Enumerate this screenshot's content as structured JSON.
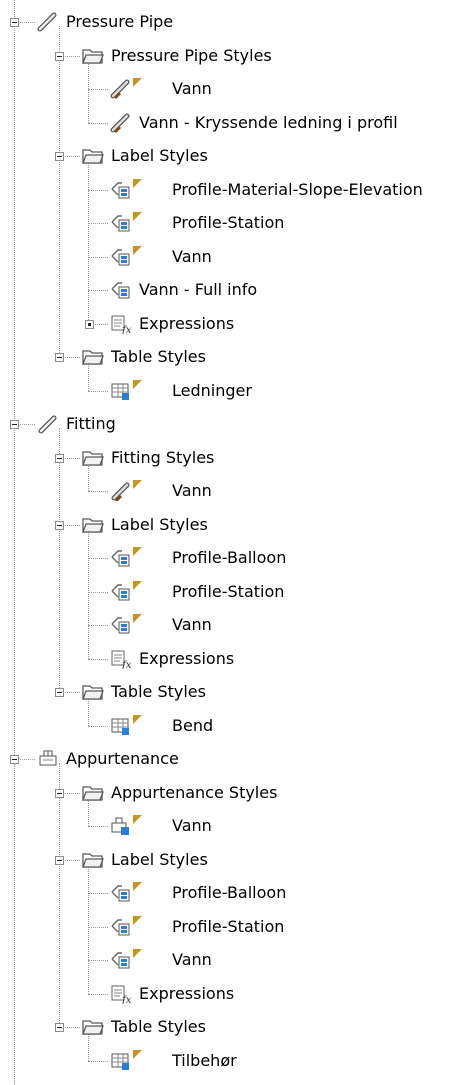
{
  "tree": [
    {
      "id": "r1",
      "label": "Pressure Pipe",
      "icon": "pipe-icon",
      "level": 0,
      "toggle": "minus"
    },
    {
      "id": "r2",
      "label": "Pressure Pipe Styles",
      "icon": "folder-icon",
      "level": 1,
      "toggle": "minus"
    },
    {
      "id": "r3",
      "label": "Vann",
      "icon": "pipe-style-icon",
      "level": 2,
      "badge": true
    },
    {
      "id": "r4",
      "label": "Vann - Kryssende ledning i profil",
      "icon": "pipe-style-icon",
      "level": 2,
      "badge": false
    },
    {
      "id": "r5",
      "label": "Label Styles",
      "icon": "folder-icon",
      "level": 1,
      "toggle": "minus"
    },
    {
      "id": "r6",
      "label": "Profile-Material-Slope-Elevation",
      "icon": "label-style-icon",
      "level": 2,
      "badge": true
    },
    {
      "id": "r7",
      "label": "Profile-Station",
      "icon": "label-style-icon",
      "level": 2,
      "badge": true
    },
    {
      "id": "r8",
      "label": "Vann",
      "icon": "label-style-icon",
      "level": 2,
      "badge": true
    },
    {
      "id": "r9",
      "label": "Vann - Full info",
      "icon": "label-style-icon",
      "level": 2,
      "badge": false
    },
    {
      "id": "r10",
      "label": "Expressions",
      "icon": "expressions-icon",
      "level": 2,
      "toggle": "dot"
    },
    {
      "id": "r11",
      "label": "Table Styles",
      "icon": "folder-icon",
      "level": 1,
      "toggle": "minus"
    },
    {
      "id": "r12",
      "label": "Ledninger",
      "icon": "table-style-icon",
      "level": 2,
      "badge": true
    },
    {
      "id": "r13",
      "label": "Fitting",
      "icon": "fitting-icon",
      "level": 0,
      "toggle": "minus"
    },
    {
      "id": "r14",
      "label": "Fitting Styles",
      "icon": "folder-icon",
      "level": 1,
      "toggle": "minus"
    },
    {
      "id": "r15",
      "label": "Vann",
      "icon": "fitting-style-icon",
      "level": 2,
      "badge": true
    },
    {
      "id": "r16",
      "label": "Label Styles",
      "icon": "folder-icon",
      "level": 1,
      "toggle": "minus"
    },
    {
      "id": "r17",
      "label": "Profile-Balloon",
      "icon": "label-style-icon",
      "level": 2,
      "badge": true
    },
    {
      "id": "r18",
      "label": "Profile-Station",
      "icon": "label-style-icon",
      "level": 2,
      "badge": true
    },
    {
      "id": "r19",
      "label": "Vann",
      "icon": "label-style-icon",
      "level": 2,
      "badge": true
    },
    {
      "id": "r20",
      "label": "Expressions",
      "icon": "expressions-icon",
      "level": 2
    },
    {
      "id": "r21",
      "label": "Table Styles",
      "icon": "folder-icon",
      "level": 1,
      "toggle": "minus"
    },
    {
      "id": "r22",
      "label": "Bend",
      "icon": "table-style-icon",
      "level": 2,
      "badge": true
    },
    {
      "id": "r23",
      "label": "Appurtenance",
      "icon": "appurtenance-icon",
      "level": 0,
      "toggle": "minus"
    },
    {
      "id": "r24",
      "label": "Appurtenance Styles",
      "icon": "folder-icon",
      "level": 1,
      "toggle": "minus"
    },
    {
      "id": "r25",
      "label": "Vann",
      "icon": "appurtenance-style-icon",
      "level": 2,
      "badge": true
    },
    {
      "id": "r26",
      "label": "Label Styles",
      "icon": "folder-icon",
      "level": 1,
      "toggle": "minus"
    },
    {
      "id": "r27",
      "label": "Profile-Balloon",
      "icon": "label-style-icon",
      "level": 2,
      "badge": true
    },
    {
      "id": "r28",
      "label": "Profile-Station",
      "icon": "label-style-icon",
      "level": 2,
      "badge": true
    },
    {
      "id": "r29",
      "label": "Vann",
      "icon": "label-style-icon",
      "level": 2,
      "badge": true
    },
    {
      "id": "r30",
      "label": "Expressions",
      "icon": "expressions-icon",
      "level": 2
    },
    {
      "id": "r31",
      "label": "Table Styles",
      "icon": "folder-icon",
      "level": 1,
      "toggle": "minus"
    },
    {
      "id": "r32",
      "label": "Tilbehør",
      "icon": "table-style-icon",
      "level": 2,
      "badge": true
    }
  ],
  "colors": {
    "badge": "#c8961e",
    "folder_stroke": "#5a5a5a",
    "icon_blue": "#2a7fd4",
    "pipe_brown": "#7a4a1e"
  }
}
